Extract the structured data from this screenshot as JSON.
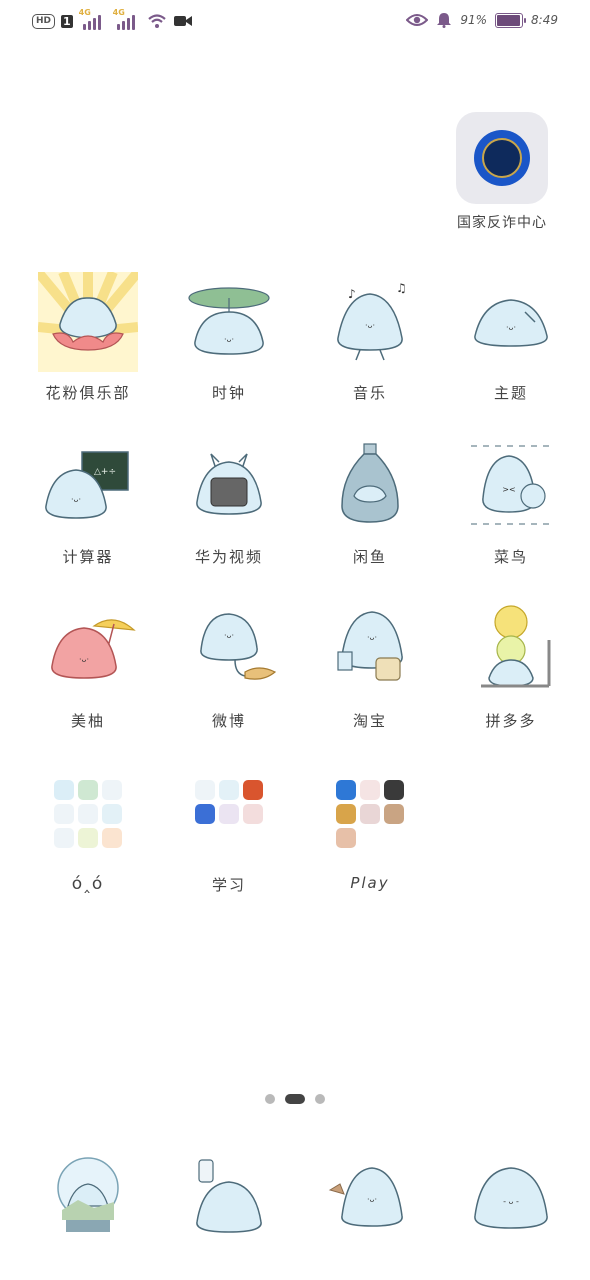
{
  "status_bar": {
    "hd": "HD",
    "sim": "1",
    "network1": "4G",
    "network2": "4G",
    "battery_text": "91%",
    "time": "8:49",
    "icons": [
      "hd-icon",
      "signal-icon",
      "wifi-icon",
      "video-icon",
      "eye-icon",
      "bell-icon",
      "battery-icon"
    ]
  },
  "apps": {
    "fraud_center": "国家反诈中心",
    "flower_club": "花粉俱乐部",
    "clock": "时钟",
    "music": "音乐",
    "theme": "主题",
    "calculator": "计算器",
    "huawei_video": "华为视频",
    "xianyu": "闲鱼",
    "cainiao": "菜鸟",
    "meiyou": "美柚",
    "weibo": "微博",
    "taobao": "淘宝",
    "pinduoduo": "拼多多",
    "folder_emote": "ό‸ό",
    "folder_study": "学习",
    "folder_play": "Play"
  },
  "pager": {
    "count": 3,
    "active": 1
  },
  "colors": {
    "mochi": "#dbeef7",
    "outline": "#4d6b7a",
    "accent": "#7b5a8a",
    "fraud_blue": "#1a56c8"
  }
}
